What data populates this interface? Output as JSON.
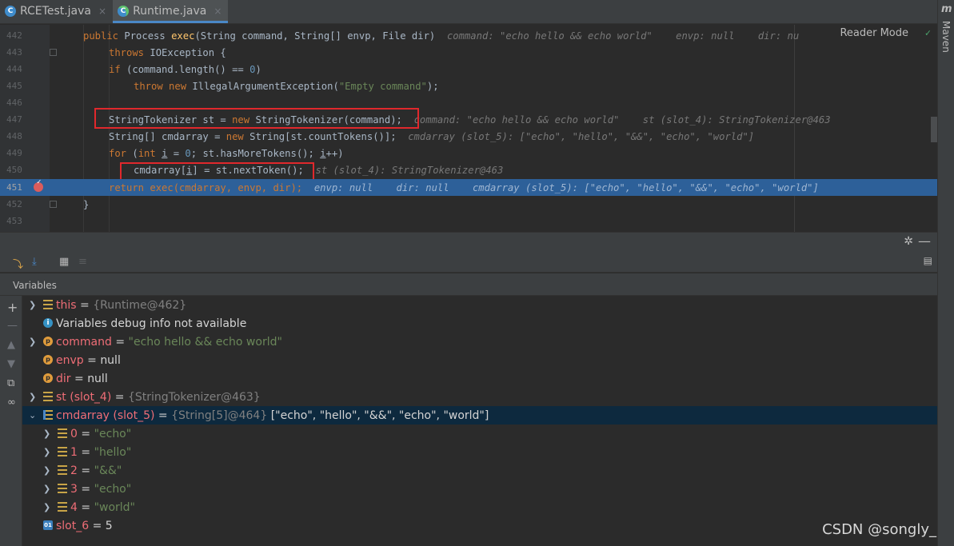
{
  "tabs": [
    {
      "label": "RCETest.java",
      "icon": "java-class-icon",
      "active": false
    },
    {
      "label": "Runtime.java",
      "icon": "java-class-icon",
      "active": true
    }
  ],
  "right_strip": {
    "letter": "m",
    "label": "Maven"
  },
  "editor": {
    "reader_mode": "Reader Mode",
    "lines": {
      "l442": {
        "num": "442",
        "kw1": "public ",
        "plain1": "Process ",
        "fn": "exec",
        "plain2": "(String command, String[] envp, File dir)",
        "inline": "  command: \"echo hello && echo world\"    envp: null    dir: nu"
      },
      "l443": {
        "num": "443",
        "kw1": "throws ",
        "plain1": "IOException {"
      },
      "l444": {
        "num": "444",
        "kw1": "if ",
        "plain1": "(command.length() == ",
        "num_val": "0",
        "plain2": ")"
      },
      "l445": {
        "num": "445",
        "kw1": "throw new ",
        "plain1": "IllegalArgumentException(",
        "str": "\"Empty command\"",
        "plain2": ");"
      },
      "l446": {
        "num": "446"
      },
      "l447": {
        "num": "447",
        "plain1": "StringTokenizer st = ",
        "kw1": "new ",
        "plain2": "StringTokenizer(command);",
        "inline": "  command: \"echo hello && echo world\"    st (slot_4): StringTokenizer@463"
      },
      "l448": {
        "num": "448",
        "plain1": "String[] cmdarray = ",
        "kw1": "new ",
        "plain2": "String[st.countTokens()];",
        "inline": "  cmdarray (slot_5): [\"echo\", \"hello\", \"&&\", \"echo\", \"world\"]"
      },
      "l449": {
        "num": "449",
        "kw1": "for ",
        "plain1": "(",
        "kw2": "int ",
        "var_i": "i",
        "plain2": " = ",
        "num_val": "0",
        "plain3": "; st.hasMoreTokens(); ",
        "var_i2": "i",
        "plain4": "++)"
      },
      "l450": {
        "num": "450",
        "plain1": "cmdarray[",
        "var_i": "i",
        "plain2": "] = st.nextToken();",
        "inline": "  st (slot_4): StringTokenizer@463"
      },
      "l451": {
        "num": "451",
        "kw1": "return ",
        "plain1": "exec(cmdarray, envp, dir);",
        "inline": "  envp: null    dir: null    cmdarray (slot_5): [\"echo\", \"hello\", \"&&\", \"echo\", \"world\"]"
      },
      "l452": {
        "num": "452",
        "plain1": "}"
      },
      "l453": {
        "num": "453"
      }
    }
  },
  "variables": {
    "title": "Variables",
    "rows": [
      {
        "name": "this",
        "eq": " = ",
        "value": "{Runtime@462}",
        "kind": "obj"
      },
      {
        "name": "Variables debug info not available",
        "kind": "info"
      },
      {
        "name": "command",
        "eq": " = ",
        "value": "\"echo hello && echo world\"",
        "kind": "str"
      },
      {
        "name": "envp",
        "eq": " = ",
        "value": "null",
        "kind": "null"
      },
      {
        "name": "dir",
        "eq": " = ",
        "value": "null",
        "kind": "null"
      },
      {
        "name": "st (slot_4)",
        "eq": " = ",
        "value": "{StringTokenizer@463}",
        "kind": "obj"
      },
      {
        "name": "cmdarray (slot_5)",
        "eq": " = ",
        "value": "{String[5]@464} ",
        "list": "[\"echo\", \"hello\", \"&&\", \"echo\", \"world\"]",
        "kind": "array"
      },
      {
        "name": "0",
        "eq": " = ",
        "value": "\"echo\"",
        "kind": "str"
      },
      {
        "name": "1",
        "eq": " = ",
        "value": "\"hello\"",
        "kind": "str"
      },
      {
        "name": "2",
        "eq": " = ",
        "value": "\"&&\"",
        "kind": "str"
      },
      {
        "name": "3",
        "eq": " = ",
        "value": "\"echo\"",
        "kind": "str"
      },
      {
        "name": "4",
        "eq": " = ",
        "value": "\"world\"",
        "kind": "str"
      },
      {
        "name": "slot_6",
        "eq": " = ",
        "value": "5",
        "kind": "num"
      }
    ]
  },
  "watermark": "CSDN @songly_",
  "colors": {
    "keyword": "#cc7832",
    "function": "#ffc66d",
    "string": "#6a8759",
    "number": "#6897bb",
    "current_line": "#2d6099",
    "highlight_box": "#e0282c",
    "selected_row": "#0d293e"
  }
}
